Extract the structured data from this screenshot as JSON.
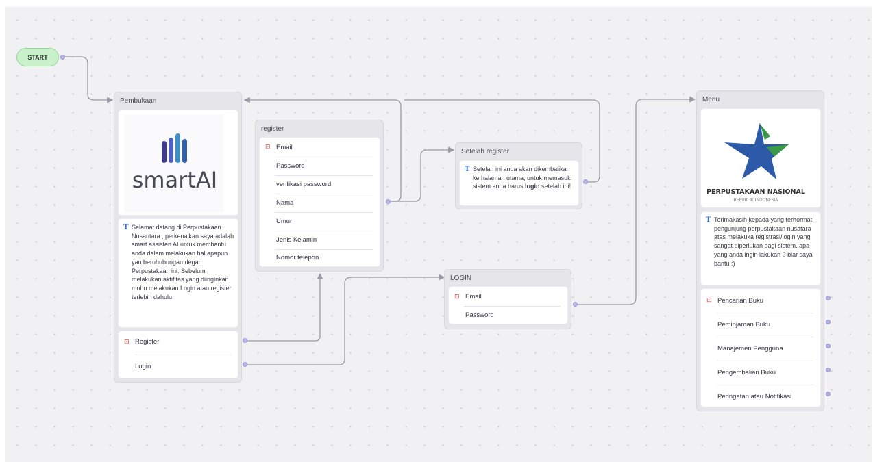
{
  "start": {
    "label": "START"
  },
  "pembukaan": {
    "title": "Pembukaan",
    "logo_text": "smartAI",
    "message": "Selamat datang di Perpustakaan Nusantara , perkenalkan saya adalah smart assisten AI untuk membantu anda dalam melakukan hal apapun yan beruhubungan degan Perpustakaan ini. Sebelum melakukan aktifitas yang diinginkan moho melakukan Login atau register terlebih dahulu",
    "options": [
      "Register",
      "Login"
    ]
  },
  "register": {
    "title": "register",
    "fields": [
      "Email",
      "Password",
      "verifikasi password",
      "Nama",
      "Umur",
      "Jenis Kelamin",
      "Nomor telepon"
    ]
  },
  "setelah_register": {
    "title": "Setelah register",
    "message_before": "Setelah ini anda akan dikembalikan ke halaman utama, untuk memasuki sistem anda harus ",
    "message_bold": "login",
    "message_after": " setelah ini!"
  },
  "login": {
    "title": "LOGIN",
    "fields": [
      "Email",
      "Password"
    ]
  },
  "menu": {
    "title": "Menu",
    "logo_title": "PERPUSTAKAAN NASIONAL",
    "logo_subtitle": "REPUBLIK INDONESIA",
    "message": "Terimakasih kepada yang terhormat pengunjung perpustakaan nusatara atas melakuka registrasi/login yang sangat diperlukan bagi sistem, apa yang anda ingin lakukan ? biar saya bantu :)",
    "options": [
      "Pencarian Buku",
      "Peminjaman Buku",
      "Manajemen Pengguna",
      "Pengembalian Buku",
      "Peringatan atau Notifikasi"
    ]
  },
  "colors": {
    "canvas": "#f1f1f3",
    "node": "#e5e5ea",
    "wire": "#9a9aa6",
    "start_fill": "#c8f1cc",
    "port": "#b7b3e8",
    "smartai_bars": [
      "#3f3a8f",
      "#4f60c0",
      "#3f8ec4",
      "#2f5fa8"
    ],
    "pnri_blue": "#2d5aa8",
    "pnri_green": "#3a9a4a"
  },
  "icons": {
    "text_block": "T-glyph-icon",
    "input_block": "red-form-icon",
    "choice_block": "red-list-icon"
  }
}
